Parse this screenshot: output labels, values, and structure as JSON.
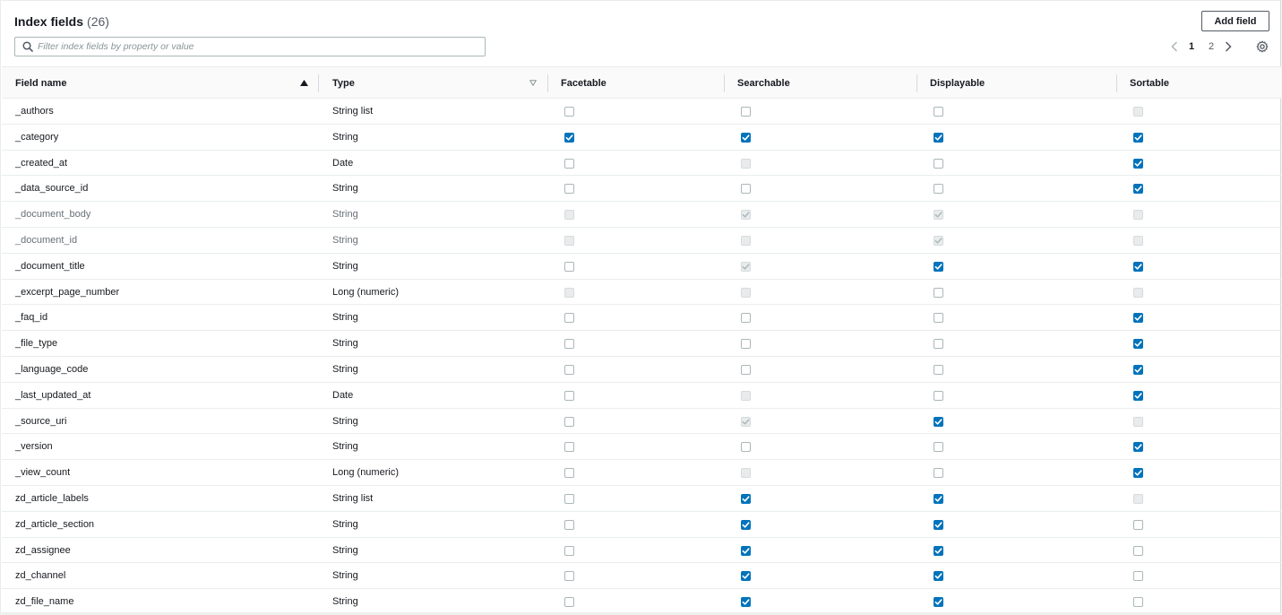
{
  "header": {
    "title": "Index fields",
    "count": "(26)"
  },
  "toolbar": {
    "add_label": "Add field"
  },
  "search": {
    "placeholder": "Filter index fields by property or value",
    "value": ""
  },
  "pagination": {
    "pages": [
      "1",
      "2"
    ],
    "current": "1"
  },
  "columns": [
    "Field name",
    "Type",
    "Facetable",
    "Searchable",
    "Displayable",
    "Sortable"
  ],
  "icons": {
    "search": "search-icon",
    "prev": "chevron-left-icon",
    "next": "chevron-right-icon",
    "settings": "gear-icon",
    "sort_asc": "sort-ascending-icon",
    "sort": "sort-icon"
  },
  "colors": {
    "accent": "#0073bb",
    "text": "#16191f",
    "muted": "#687078"
  },
  "checkbox_states_legend": "u=unchecked, c=checked, d=disabled unchecked, x=disabled checked",
  "rows": [
    {
      "name": "_authors",
      "type": "String list",
      "disabled": false,
      "flags": [
        "u",
        "u",
        "u",
        "d"
      ]
    },
    {
      "name": "_category",
      "type": "String",
      "disabled": false,
      "flags": [
        "c",
        "c",
        "c",
        "c"
      ]
    },
    {
      "name": "_created_at",
      "type": "Date",
      "disabled": false,
      "flags": [
        "u",
        "d",
        "u",
        "c"
      ]
    },
    {
      "name": "_data_source_id",
      "type": "String",
      "disabled": false,
      "flags": [
        "u",
        "u",
        "u",
        "c"
      ]
    },
    {
      "name": "_document_body",
      "type": "String",
      "disabled": true,
      "flags": [
        "d",
        "x",
        "x",
        "d"
      ]
    },
    {
      "name": "_document_id",
      "type": "String",
      "disabled": true,
      "flags": [
        "d",
        "d",
        "x",
        "d"
      ]
    },
    {
      "name": "_document_title",
      "type": "String",
      "disabled": false,
      "flags": [
        "u",
        "x",
        "c",
        "c"
      ]
    },
    {
      "name": "_excerpt_page_number",
      "type": "Long (numeric)",
      "disabled": false,
      "flags": [
        "d",
        "d",
        "u",
        "d"
      ]
    },
    {
      "name": "_faq_id",
      "type": "String",
      "disabled": false,
      "flags": [
        "u",
        "u",
        "u",
        "c"
      ]
    },
    {
      "name": "_file_type",
      "type": "String",
      "disabled": false,
      "flags": [
        "u",
        "u",
        "u",
        "c"
      ]
    },
    {
      "name": "_language_code",
      "type": "String",
      "disabled": false,
      "flags": [
        "u",
        "u",
        "u",
        "c"
      ]
    },
    {
      "name": "_last_updated_at",
      "type": "Date",
      "disabled": false,
      "flags": [
        "u",
        "d",
        "u",
        "c"
      ]
    },
    {
      "name": "_source_uri",
      "type": "String",
      "disabled": false,
      "flags": [
        "u",
        "x",
        "c",
        "d"
      ]
    },
    {
      "name": "_version",
      "type": "String",
      "disabled": false,
      "flags": [
        "u",
        "u",
        "u",
        "c"
      ]
    },
    {
      "name": "_view_count",
      "type": "Long (numeric)",
      "disabled": false,
      "flags": [
        "u",
        "d",
        "u",
        "c"
      ]
    },
    {
      "name": "zd_article_labels",
      "type": "String list",
      "disabled": false,
      "flags": [
        "u",
        "c",
        "c",
        "d"
      ]
    },
    {
      "name": "zd_article_section",
      "type": "String",
      "disabled": false,
      "flags": [
        "u",
        "c",
        "c",
        "u"
      ]
    },
    {
      "name": "zd_assignee",
      "type": "String",
      "disabled": false,
      "flags": [
        "u",
        "c",
        "c",
        "u"
      ]
    },
    {
      "name": "zd_channel",
      "type": "String",
      "disabled": false,
      "flags": [
        "u",
        "c",
        "c",
        "u"
      ]
    },
    {
      "name": "zd_file_name",
      "type": "String",
      "disabled": false,
      "flags": [
        "u",
        "c",
        "c",
        "u"
      ]
    }
  ]
}
